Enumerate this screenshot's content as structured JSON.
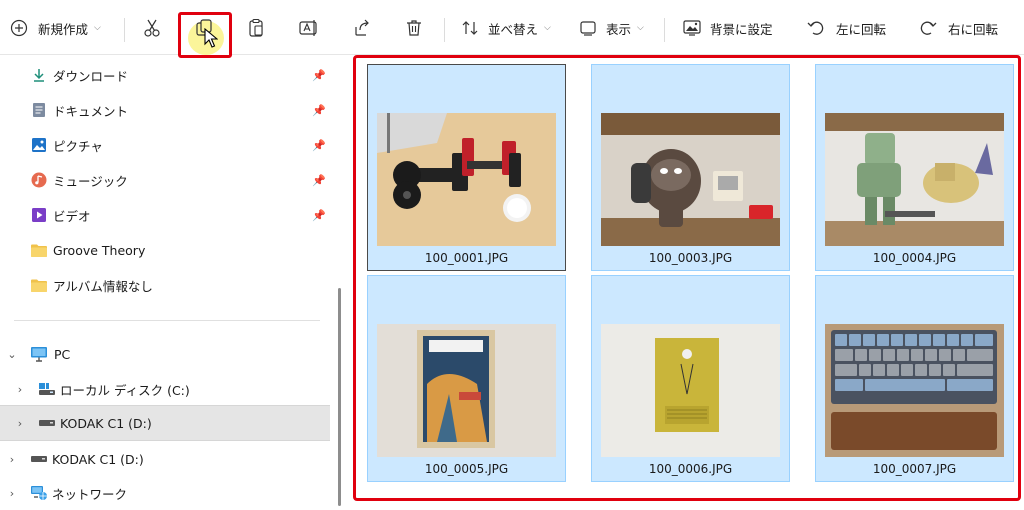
{
  "toolbar": {
    "new_label": "新規作成",
    "sort_label": "並べ替え",
    "view_label": "表示",
    "background_label": "背景に設定",
    "rotate_left_label": "左に回転",
    "rotate_right_label": "右に回転"
  },
  "sidebar": {
    "quick_access": [
      {
        "label": "ダウンロード"
      },
      {
        "label": "ドキュメント"
      },
      {
        "label": "ピクチャ"
      },
      {
        "label": "ミュージック"
      },
      {
        "label": "ビデオ"
      },
      {
        "label": "Groove Theory"
      },
      {
        "label": "アルバム情報なし"
      }
    ],
    "tree": [
      {
        "label": "PC"
      },
      {
        "label": "ローカル ディスク (C:)"
      },
      {
        "label": "KODAK C1 (D:)"
      },
      {
        "label": "KODAK C1 (D:)"
      },
      {
        "label": "ネットワーク"
      }
    ]
  },
  "files": [
    {
      "name": "100_0001.JPG"
    },
    {
      "name": "100_0003.JPG"
    },
    {
      "name": "100_0004.JPG"
    },
    {
      "name": "100_0005.JPG"
    },
    {
      "name": "100_0006.JPG"
    },
    {
      "name": "100_0007.JPG"
    }
  ],
  "colors": {
    "highlight_red": "#e0000e",
    "selection_blue": "#cce8ff",
    "selection_border": "#99d1ff"
  }
}
